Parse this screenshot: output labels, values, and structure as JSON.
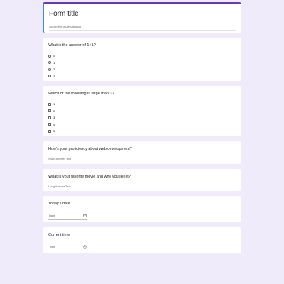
{
  "header": {
    "title": "Form title",
    "description": "Some form description"
  },
  "questions": [
    {
      "title": "What is the answer of 1+1?",
      "type": "radio",
      "options": [
        "0",
        "1",
        "2",
        "3"
      ]
    },
    {
      "title": "Which of the following is large than 3?",
      "type": "checkbox",
      "options": [
        "1",
        "2",
        "3",
        "4",
        "5"
      ]
    },
    {
      "title": "How's your proficiency about web development?",
      "type": "short",
      "placeholder": "Short Answer Text"
    },
    {
      "title": "What is your favorite movie and why you like it?",
      "type": "long",
      "placeholder": "Long Answer Text"
    },
    {
      "title": "Today's date",
      "type": "date",
      "field_label": "Date",
      "icon": "calendar-icon"
    },
    {
      "title": "Current time",
      "type": "time",
      "field_label": "Time",
      "icon": "clock-icon"
    }
  ],
  "colors": {
    "background": "#efebfa",
    "accent_top": "#673ab7",
    "accent_left": "#4285f4"
  }
}
